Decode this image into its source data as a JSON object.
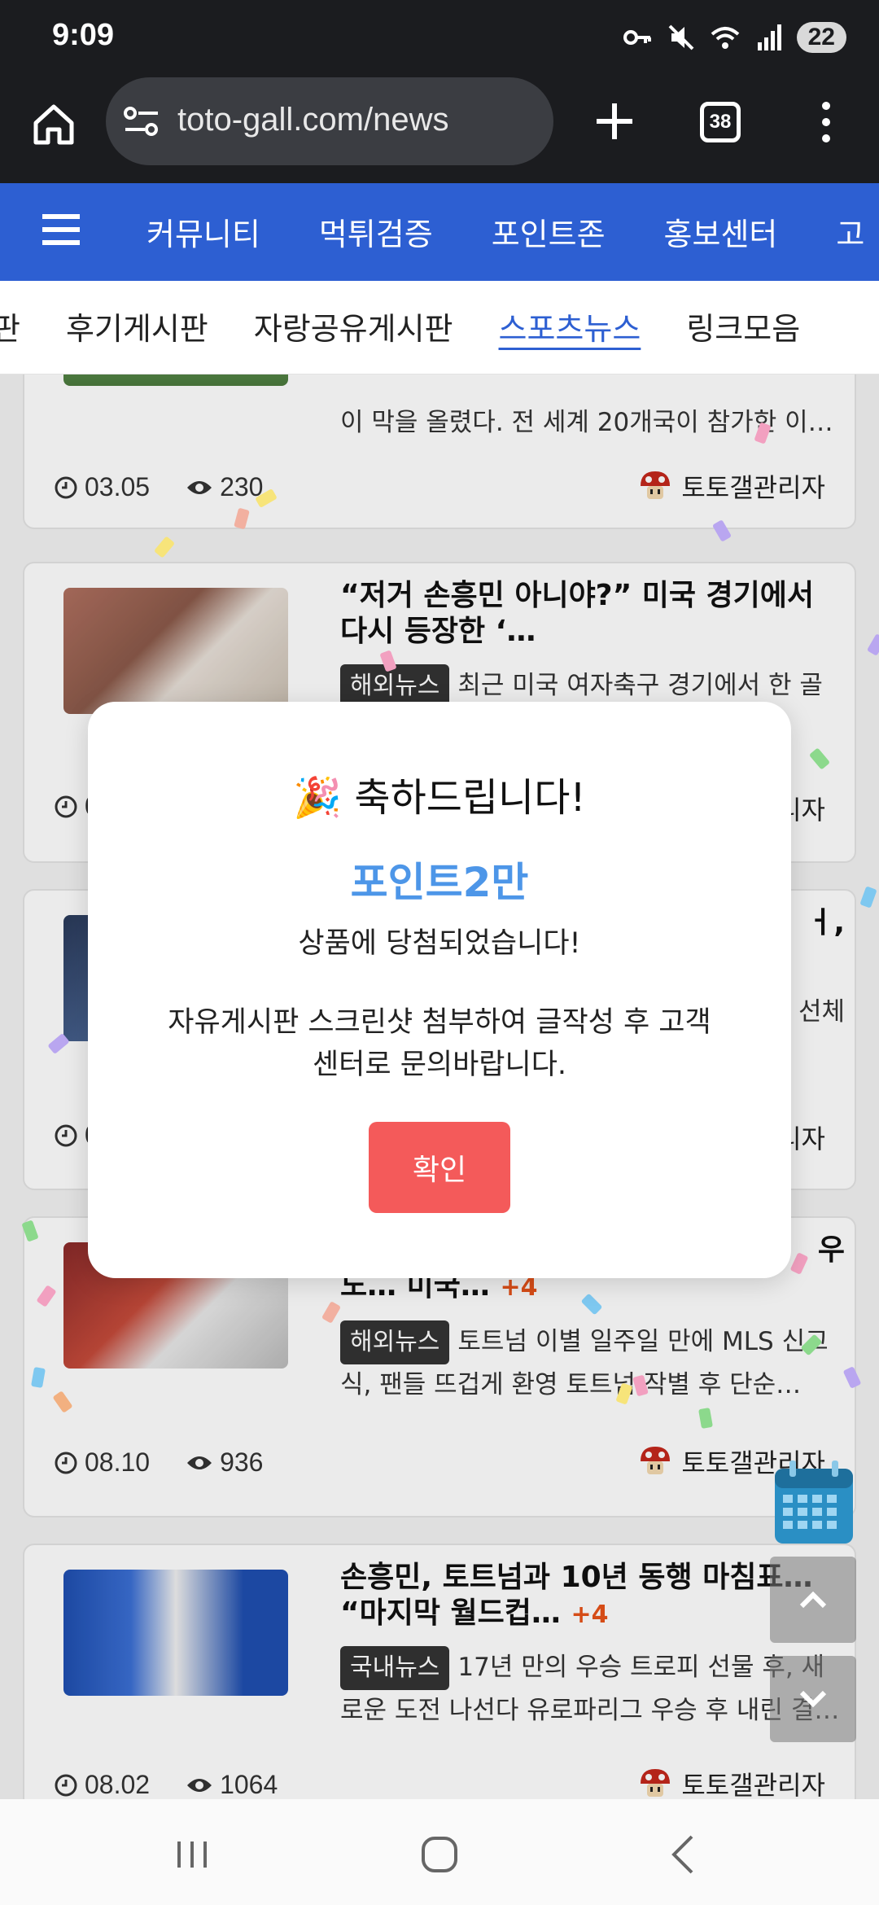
{
  "status_bar": {
    "time": "9:09",
    "battery": "22"
  },
  "browser": {
    "url": "toto-gall.com/news",
    "tab_count": "38"
  },
  "site_nav": {
    "items": [
      "커뮤니티",
      "먹튀검증",
      "포인트존",
      "홍보센터",
      "고"
    ]
  },
  "sub_nav": {
    "items": [
      "판",
      "후기게시판",
      "자랑공유게시판",
      "스포츠뉴스",
      "링크모음"
    ],
    "active": "스포츠뉴스"
  },
  "posts": [
    {
      "title": "",
      "category": "",
      "excerpt": "이 막을 올렸다. 전 세계 20개국이 참가한 이…",
      "date": "03.05",
      "views": "230",
      "author": "토토갤관리자"
    },
    {
      "title": "“저거 손흥민 아니야?” 미국 경기에서 다시 등장한 ‘…",
      "category": "해외뉴스",
      "excerpt": "최근 미국 여자축구 경기에서 한 골",
      "date": "0",
      "views": "",
      "author": "리자"
    },
    {
      "title": "ㅓ,",
      "category": "",
      "excerpt": "선체",
      "date": "0",
      "views": "",
      "author": "리자"
    },
    {
      "title": "노… 미국…",
      "title_prefix": "우",
      "plus": "+4",
      "category": "해외뉴스",
      "excerpt": "토트넘 이별 일주일 만에 MLS 신고식, 팬들 뜨겁게 환영 토트넘 작별 후 단순…",
      "date": "08.10",
      "views": "936",
      "author": "토토갤관리자"
    },
    {
      "title": "손흥민, 토트넘과 10년 동행 마침표… “마지막 월드컵…",
      "plus": "+4",
      "category": "국내뉴스",
      "excerpt": "17년 만의 우승 트로피 선물 후, 새로운 도전 나선다 유로파리그 우승 후 내린 결…",
      "date": "08.02",
      "views": "1064",
      "author": "토토갤관리자"
    }
  ],
  "modal": {
    "emoji": "🎉",
    "title": "축하드립니다!",
    "prize": "포인트2만",
    "won_text": "상품에 당첨되었습니다!",
    "instruction": "자유게시판 스크린샷 첨부하여 글작성 후 고객센터로 문의바랍니다.",
    "confirm_label": "확인"
  },
  "colors": {
    "nav_blue": "#2d5fd2",
    "prize_blue": "#4d96e8",
    "confirm_red": "#f45a5a",
    "plus_orange": "#e8531a"
  }
}
